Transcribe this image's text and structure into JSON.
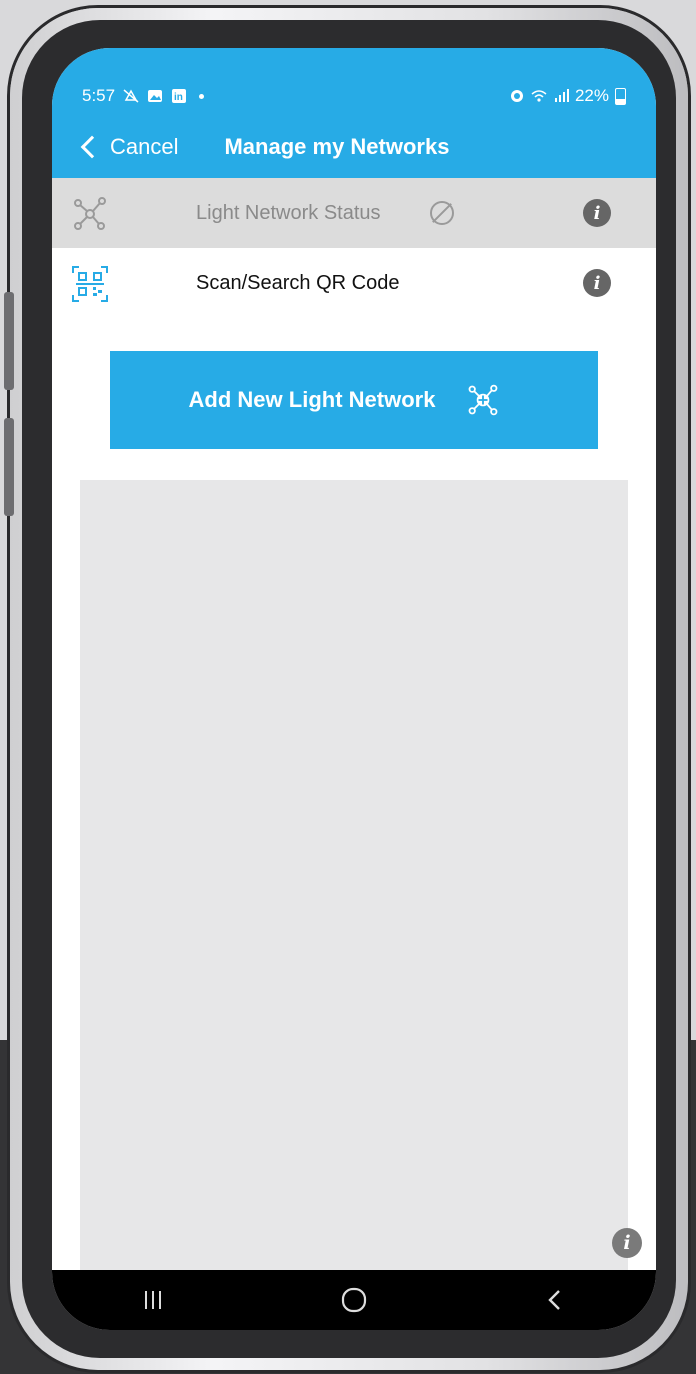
{
  "status_bar": {
    "time": "5:57",
    "battery": "22%",
    "icons_left": [
      "notifications-off-icon",
      "gallery-icon",
      "linkedin-icon",
      "dot-icon"
    ],
    "icons_right": [
      "alarm-icon",
      "wifi-icon",
      "signal-icon",
      "battery-icon"
    ]
  },
  "header": {
    "cancel_label": "Cancel",
    "title": "Manage my Networks"
  },
  "rows": [
    {
      "label": "Light Network Status",
      "icon": "network-icon",
      "status_icon": "prohibited-icon",
      "info_icon": "info-icon",
      "enabled": false
    },
    {
      "label": "Scan/Search QR Code",
      "icon": "qr-code-icon",
      "info_icon": "info-icon",
      "enabled": true
    }
  ],
  "add_button": {
    "label": "Add New Light Network",
    "icon": "add-network-icon"
  },
  "navbar": {
    "buttons": [
      "recents-button",
      "home-button",
      "back-button"
    ]
  },
  "colors": {
    "accent": "#27abe6",
    "disabled_row": "#dcdcdc",
    "content_area": "#e7e7e8"
  }
}
